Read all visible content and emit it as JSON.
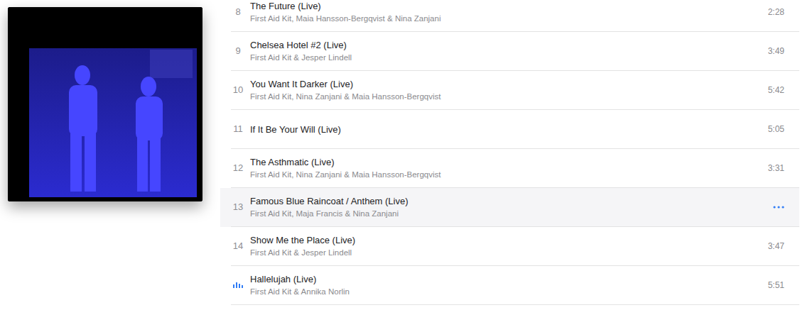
{
  "album": {
    "artwork": "album-cover"
  },
  "tracks": [
    {
      "number": "8",
      "title": "The Future (Live)",
      "artists": "First Aid Kit, Maia Hansson-Bergqvist & Nina Zanjani",
      "duration": "2:28",
      "selected": false,
      "playing": false
    },
    {
      "number": "9",
      "title": "Chelsea Hotel #2 (Live)",
      "artists": "First Aid Kit & Jesper Lindell",
      "duration": "3:49",
      "selected": false,
      "playing": false
    },
    {
      "number": "10",
      "title": "You Want It Darker (Live)",
      "artists": "First Aid Kit, Nina Zanjani & Maia Hansson-Bergqvist",
      "duration": "5:42",
      "selected": false,
      "playing": false
    },
    {
      "number": "11",
      "title": "If It Be Your Will (Live)",
      "artists": "",
      "duration": "5:05",
      "selected": false,
      "playing": false
    },
    {
      "number": "12",
      "title": "The Asthmatic (Live)",
      "artists": "First Aid Kit, Nina Zanjani & Maia Hansson-Bergqvist",
      "duration": "3:31",
      "selected": false,
      "playing": false
    },
    {
      "number": "13",
      "title": "Famous Blue Raincoat / Anthem (Live)",
      "artists": "First Aid Kit, Maja Francis & Nina Zanjani",
      "duration": "",
      "selected": true,
      "playing": false
    },
    {
      "number": "14",
      "title": "Show Me the Place (Live)",
      "artists": "First Aid Kit & Jesper Lindell",
      "duration": "3:47",
      "selected": false,
      "playing": false
    },
    {
      "number": "",
      "title": "Hallelujah (Live)",
      "artists": "First Aid Kit & Annika Norlin",
      "duration": "5:51",
      "selected": false,
      "playing": true
    }
  ]
}
